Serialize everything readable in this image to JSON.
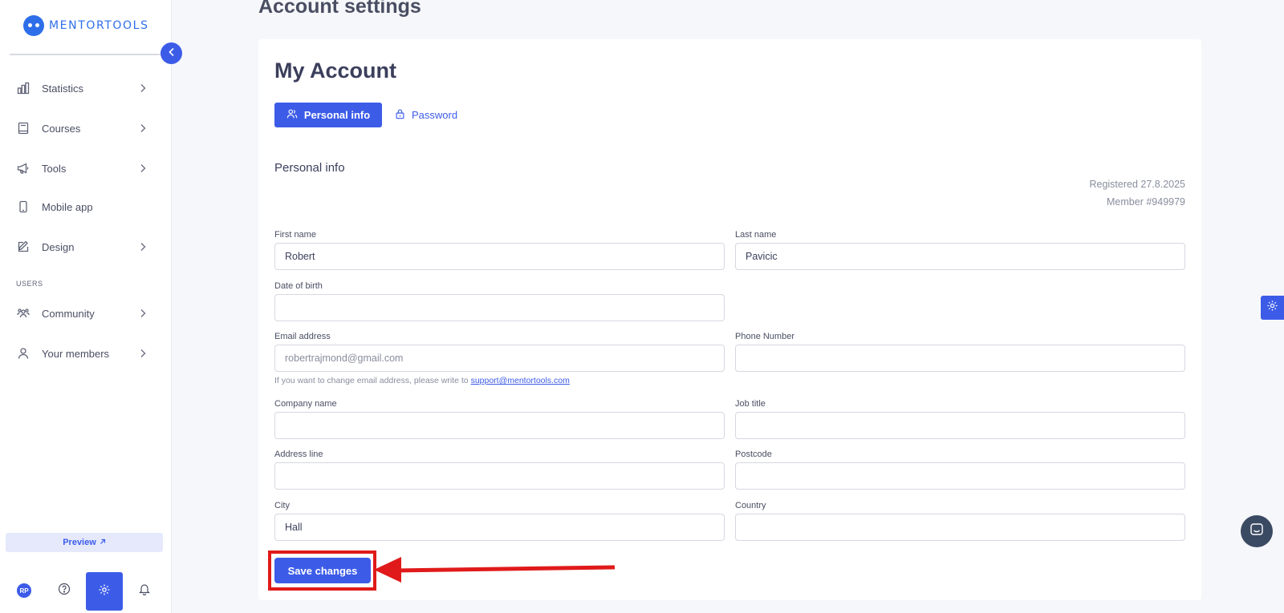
{
  "logo": {
    "text": "MENTORTOOLS"
  },
  "sidebar": {
    "items": [
      {
        "label": "Statistics",
        "icon": "bar-chart-icon"
      },
      {
        "label": "Courses",
        "icon": "book-icon"
      },
      {
        "label": "Tools",
        "icon": "megaphone-icon"
      },
      {
        "label": "Mobile app",
        "icon": "phone-icon"
      },
      {
        "label": "Design",
        "icon": "pencil-icon"
      }
    ],
    "section_users": "USERS",
    "user_items": [
      {
        "label": "Community",
        "icon": "community-icon"
      },
      {
        "label": "Your members",
        "icon": "user-icon"
      }
    ],
    "preview_label": "Preview",
    "avatar_initials": "RP"
  },
  "page": {
    "heading": "Account settings",
    "card_title": "My Account",
    "tabs": {
      "personal": "Personal info",
      "password": "Password"
    },
    "section_title": "Personal info",
    "registered": "Registered 27.8.2025",
    "member": "Member #949979"
  },
  "form": {
    "first_name": {
      "label": "First name",
      "value": "Robert"
    },
    "last_name": {
      "label": "Last name",
      "value": "Pavicic"
    },
    "dob": {
      "label": "Date of birth",
      "value": ""
    },
    "email": {
      "label": "Email address",
      "value": "robertrajmond@gmail.com"
    },
    "phone": {
      "label": "Phone Number",
      "value": ""
    },
    "email_hint": "If you want to change email address, please write to",
    "support_email": "support@mentortools.com",
    "company": {
      "label": "Company name",
      "value": ""
    },
    "job_title": {
      "label": "Job title",
      "value": ""
    },
    "address": {
      "label": "Address line",
      "value": ""
    },
    "postcode": {
      "label": "Postcode",
      "value": ""
    },
    "city": {
      "label": "City",
      "value": "Hall"
    },
    "country": {
      "label": "Country",
      "value": ""
    },
    "save_label": "Save changes"
  },
  "colors": {
    "accent": "#3c5ce8",
    "highlight": "#e01a1a",
    "chat": "#3b4a63"
  }
}
